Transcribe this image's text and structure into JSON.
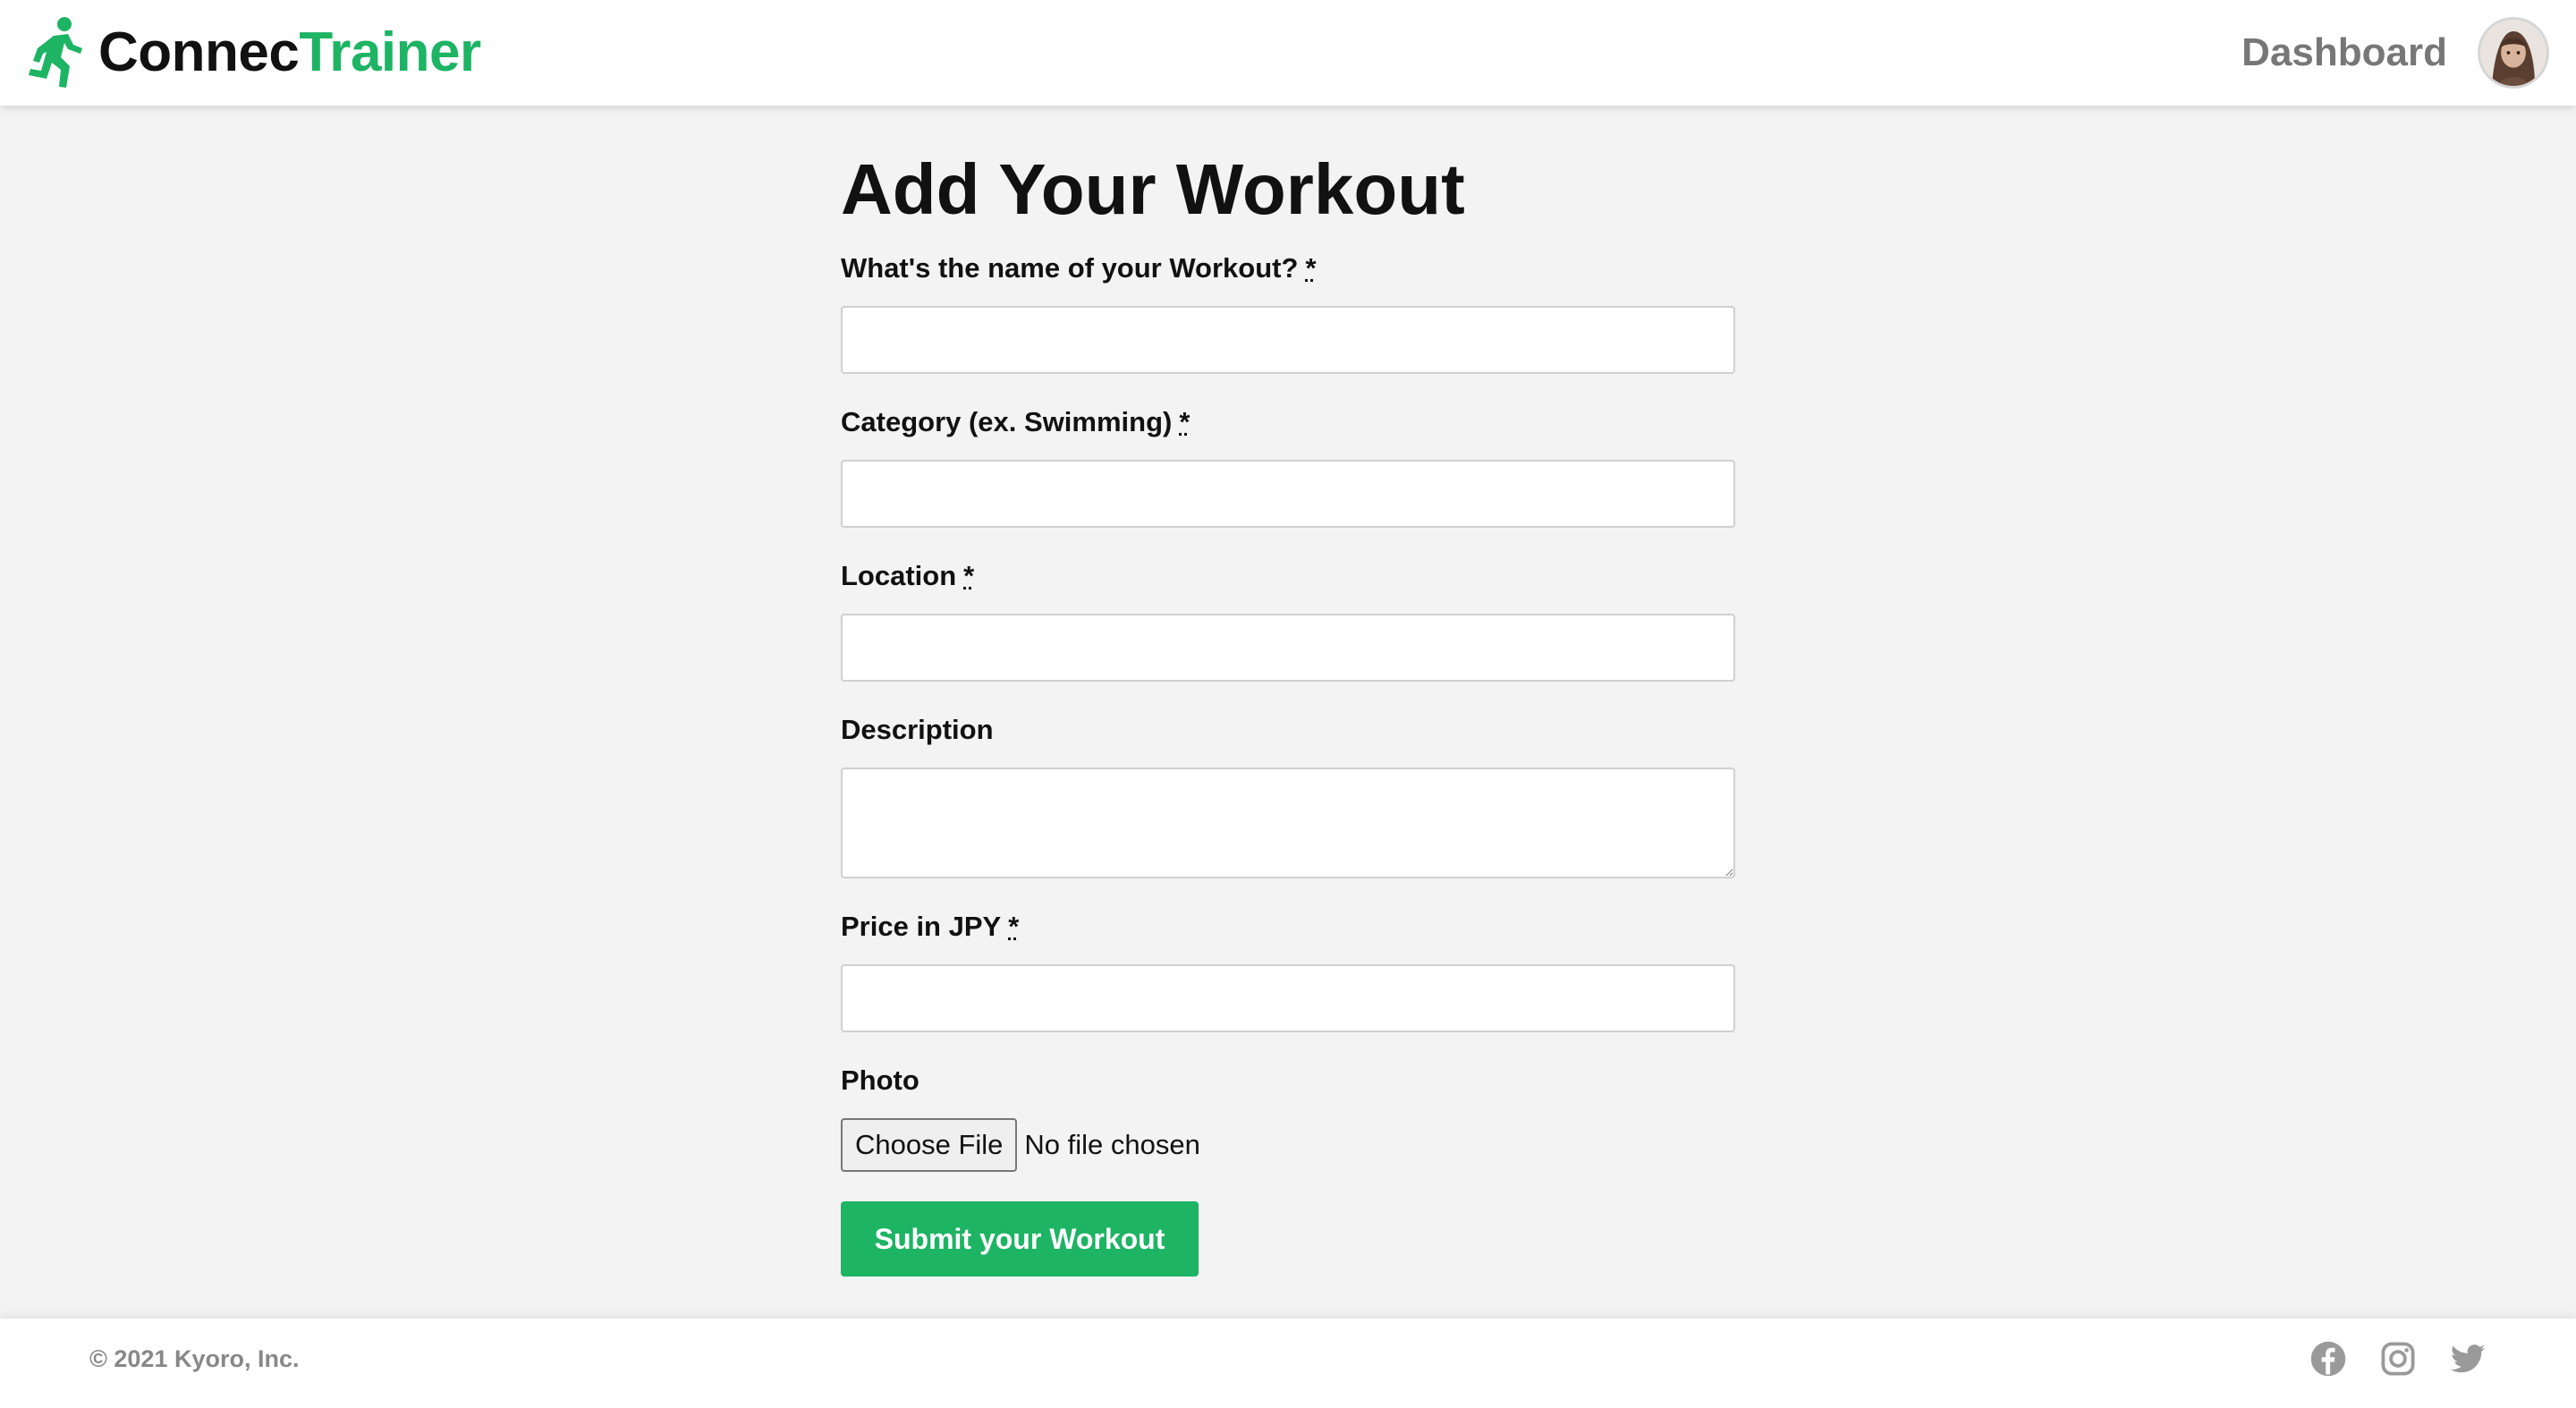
{
  "colors": {
    "brand_green": "#1db464",
    "brand_dark": "#111111",
    "muted": "#777777"
  },
  "navbar": {
    "brand_part1": "Connec",
    "brand_part2": "Trainer",
    "brand_icon": "running-person-icon",
    "dashboard_label": "Dashboard",
    "avatar_icon": "user-avatar"
  },
  "form": {
    "title": "Add Your Workout",
    "required_marker": "*",
    "fields": {
      "name": {
        "label": "What's the name of your Workout?",
        "value": ""
      },
      "category": {
        "label": "Category (ex. Swimming)",
        "value": ""
      },
      "location": {
        "label": "Location",
        "value": ""
      },
      "description": {
        "label": "Description",
        "value": ""
      },
      "price": {
        "label": "Price in JPY",
        "value": ""
      },
      "photo": {
        "label": "Photo",
        "button_label": "Choose File",
        "status": "No file chosen"
      }
    },
    "submit_label": "Submit your Workout"
  },
  "footer": {
    "copyright": "© 2021 Kyoro, Inc.",
    "social_icons": [
      "facebook-icon",
      "instagram-icon",
      "twitter-icon"
    ]
  }
}
